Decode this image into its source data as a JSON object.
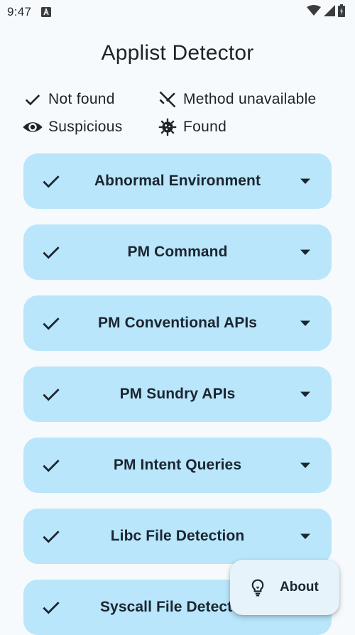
{
  "status_bar": {
    "time": "9:47",
    "icons": [
      "notification-a-icon",
      "wifi-icon",
      "cell-signal-icon",
      "battery-icon"
    ]
  },
  "app": {
    "title": "Applist Detector"
  },
  "legend": {
    "items": [
      {
        "icon": "check-icon",
        "label": "Not found"
      },
      {
        "icon": "no-method-icon",
        "label": "Method unavailable"
      },
      {
        "icon": "eye-icon",
        "label": "Suspicious"
      },
      {
        "icon": "virus-icon",
        "label": "Found"
      }
    ]
  },
  "detections": [
    {
      "label": "Abnormal Environment",
      "status": "not-found"
    },
    {
      "label": "PM Command",
      "status": "not-found"
    },
    {
      "label": "PM Conventional APIs",
      "status": "not-found"
    },
    {
      "label": "PM Sundry APIs",
      "status": "not-found"
    },
    {
      "label": "PM Intent Queries",
      "status": "not-found"
    },
    {
      "label": "Libc File Detection",
      "status": "not-found"
    },
    {
      "label": "Syscall File Detection",
      "status": "not-found"
    }
  ],
  "fab": {
    "icon": "lightbulb-icon",
    "label": "About"
  },
  "colors": {
    "background": "#f7fafd",
    "card": "#b9e6fb",
    "fab": "#e6f3fb",
    "text": "#1b2530"
  }
}
